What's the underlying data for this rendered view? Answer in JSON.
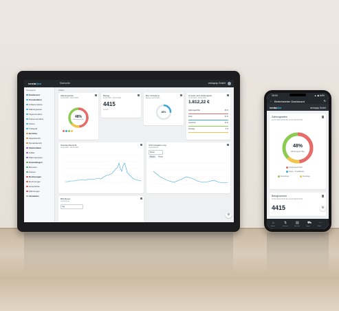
{
  "tablet": {
    "logo": {
      "brand": "venta",
      "accent": "line"
    },
    "top_menu": "Startseite",
    "company": "ventapay GmbH",
    "breadcrumb": "Status",
    "sidebar": {
      "section_label": "Navigation",
      "items": [
        {
          "label": "Dashboard",
          "color": "#2c8fd6",
          "kind": "cat",
          "active": true
        },
        {
          "label": "Umsatzdaten",
          "color": "#3bb0e0",
          "kind": "cat"
        },
        {
          "label": "Artikelumsätze",
          "color": "#3bb0e0",
          "kind": "item"
        },
        {
          "label": "Zahlungsarten",
          "color": "#3bb0e0",
          "kind": "item"
        },
        {
          "label": "Tagesumsätze",
          "color": "#3bb0e0",
          "kind": "item"
        },
        {
          "label": "Kassenumsätze",
          "color": "#3bb0e0",
          "kind": "item"
        },
        {
          "label": "Storno",
          "color": "#3bb0e0",
          "kind": "item"
        },
        {
          "label": "Trinkgeld",
          "color": "#3bb0e0",
          "kind": "item"
        },
        {
          "label": "Berichte",
          "color": "#e0883b",
          "kind": "cat"
        },
        {
          "label": "Tagesbericht",
          "color": "#e0883b",
          "kind": "item"
        },
        {
          "label": "Monatsbericht",
          "color": "#e0883b",
          "kind": "item"
        },
        {
          "label": "Stammdaten",
          "color": "#8e5bd6",
          "kind": "cat"
        },
        {
          "label": "Artikel",
          "color": "#8e5bd6",
          "kind": "item"
        },
        {
          "label": "Warengruppen",
          "color": "#8e5bd6",
          "kind": "item"
        },
        {
          "label": "Einstellungen",
          "color": "#46b36b",
          "kind": "cat"
        },
        {
          "label": "Benutzer",
          "color": "#46b36b",
          "kind": "item"
        },
        {
          "label": "Kassen",
          "color": "#46b36b",
          "kind": "item"
        },
        {
          "label": "Rechnungen",
          "color": "#e04b5b",
          "kind": "cat"
        },
        {
          "label": "Rechnungen",
          "color": "#e04b5b",
          "kind": "item"
        },
        {
          "label": "Gutschriften",
          "color": "#e04b5b",
          "kind": "item"
        },
        {
          "label": "Mahnungen",
          "color": "#e04b5b",
          "kind": "item"
        },
        {
          "label": "Abmelden",
          "color": "#9aa6b0",
          "kind": "cat"
        }
      ]
    },
    "cards": {
      "zahlungsarten": {
        "title": "Zahlungsarten",
        "subtitle": "01.02.2023 - 28.02.2023",
        "percent": "48%",
        "center_label": "Zahlungsart Bar"
      },
      "belege": {
        "title": "Belege",
        "subtitle": "01.02.2023 - 28.02.2023",
        "value": "4415",
        "note": "Anzahl"
      },
      "bon_verteilung": {
        "title": "Bon Verteilung",
        "subtitle": "Belege nach Kasse",
        "percent": "26%"
      },
      "umsatz": {
        "title": "Umsatz nach Zahlungsart",
        "subtitle": "01.02.2023 - 28.02.2023",
        "value": "1.812,22 €",
        "rows": [
          {
            "label": "Zahlungsart Bar",
            "value": "48 %"
          },
          {
            "label": "Karte",
            "value": "31 %"
          },
          {
            "label": "Gutschein",
            "value": "12 %"
          },
          {
            "label": "Sonstige",
            "value": "9 %"
          }
        ]
      },
      "stunden": {
        "title": "Stundenübersicht",
        "subtitle": "01.02.2023 - 28.02.2023"
      },
      "co2": {
        "title": "CO2 Ausgabe in kg",
        "subtitle": "Umweltbilanz",
        "select": "Monat",
        "tabs": [
          "Woche",
          "Monat"
        ]
      },
      "bons": {
        "title": "Bild Boxen",
        "subtitle": "Auswertung",
        "select": "Tag"
      }
    }
  },
  "phone": {
    "status_time": "15:24",
    "status_right": "▲ ◆ 64%",
    "title": "Betriebsleiter Dashboard",
    "logo": {
      "brand": "venta",
      "accent": "line"
    },
    "company": "ventapay GmbH",
    "card1": {
      "title": "Zahlungsarten",
      "subtitle": "01.02.2023 00:00 bis 01.03.2023 00:00",
      "percent": "48%",
      "center_label": "Zahlungsart Bar",
      "legend": [
        {
          "label": "Zahlungsart Bar",
          "color": "#e96a6a"
        },
        {
          "label": "Karte / Kreditkarte",
          "color": "#3aa7d6"
        },
        {
          "label": "Gutschein",
          "color": "#8ccb53"
        },
        {
          "label": "Sonstige",
          "color": "#f2c44c"
        }
      ]
    },
    "card2": {
      "title": "Belegnummer",
      "subtitle": "01.02.2023 00:00 bis 01.03.2023 00:00",
      "value": "4415"
    },
    "nav": [
      {
        "icon": "⌂",
        "label": "Home"
      },
      {
        "icon": "⇅",
        "label": "Umsatz"
      },
      {
        "icon": "▤",
        "label": "Berichte"
      },
      {
        "icon": "⛟",
        "label": "Lager"
      },
      {
        "icon": "⋯",
        "label": "Mehr"
      }
    ]
  },
  "colors": {
    "accent_blue": "#3aa7d6",
    "donut_red": "#e96a6a",
    "donut_green": "#8ccb53",
    "donut_yellow": "#f2c44c",
    "dark_bar": "#23282d"
  }
}
